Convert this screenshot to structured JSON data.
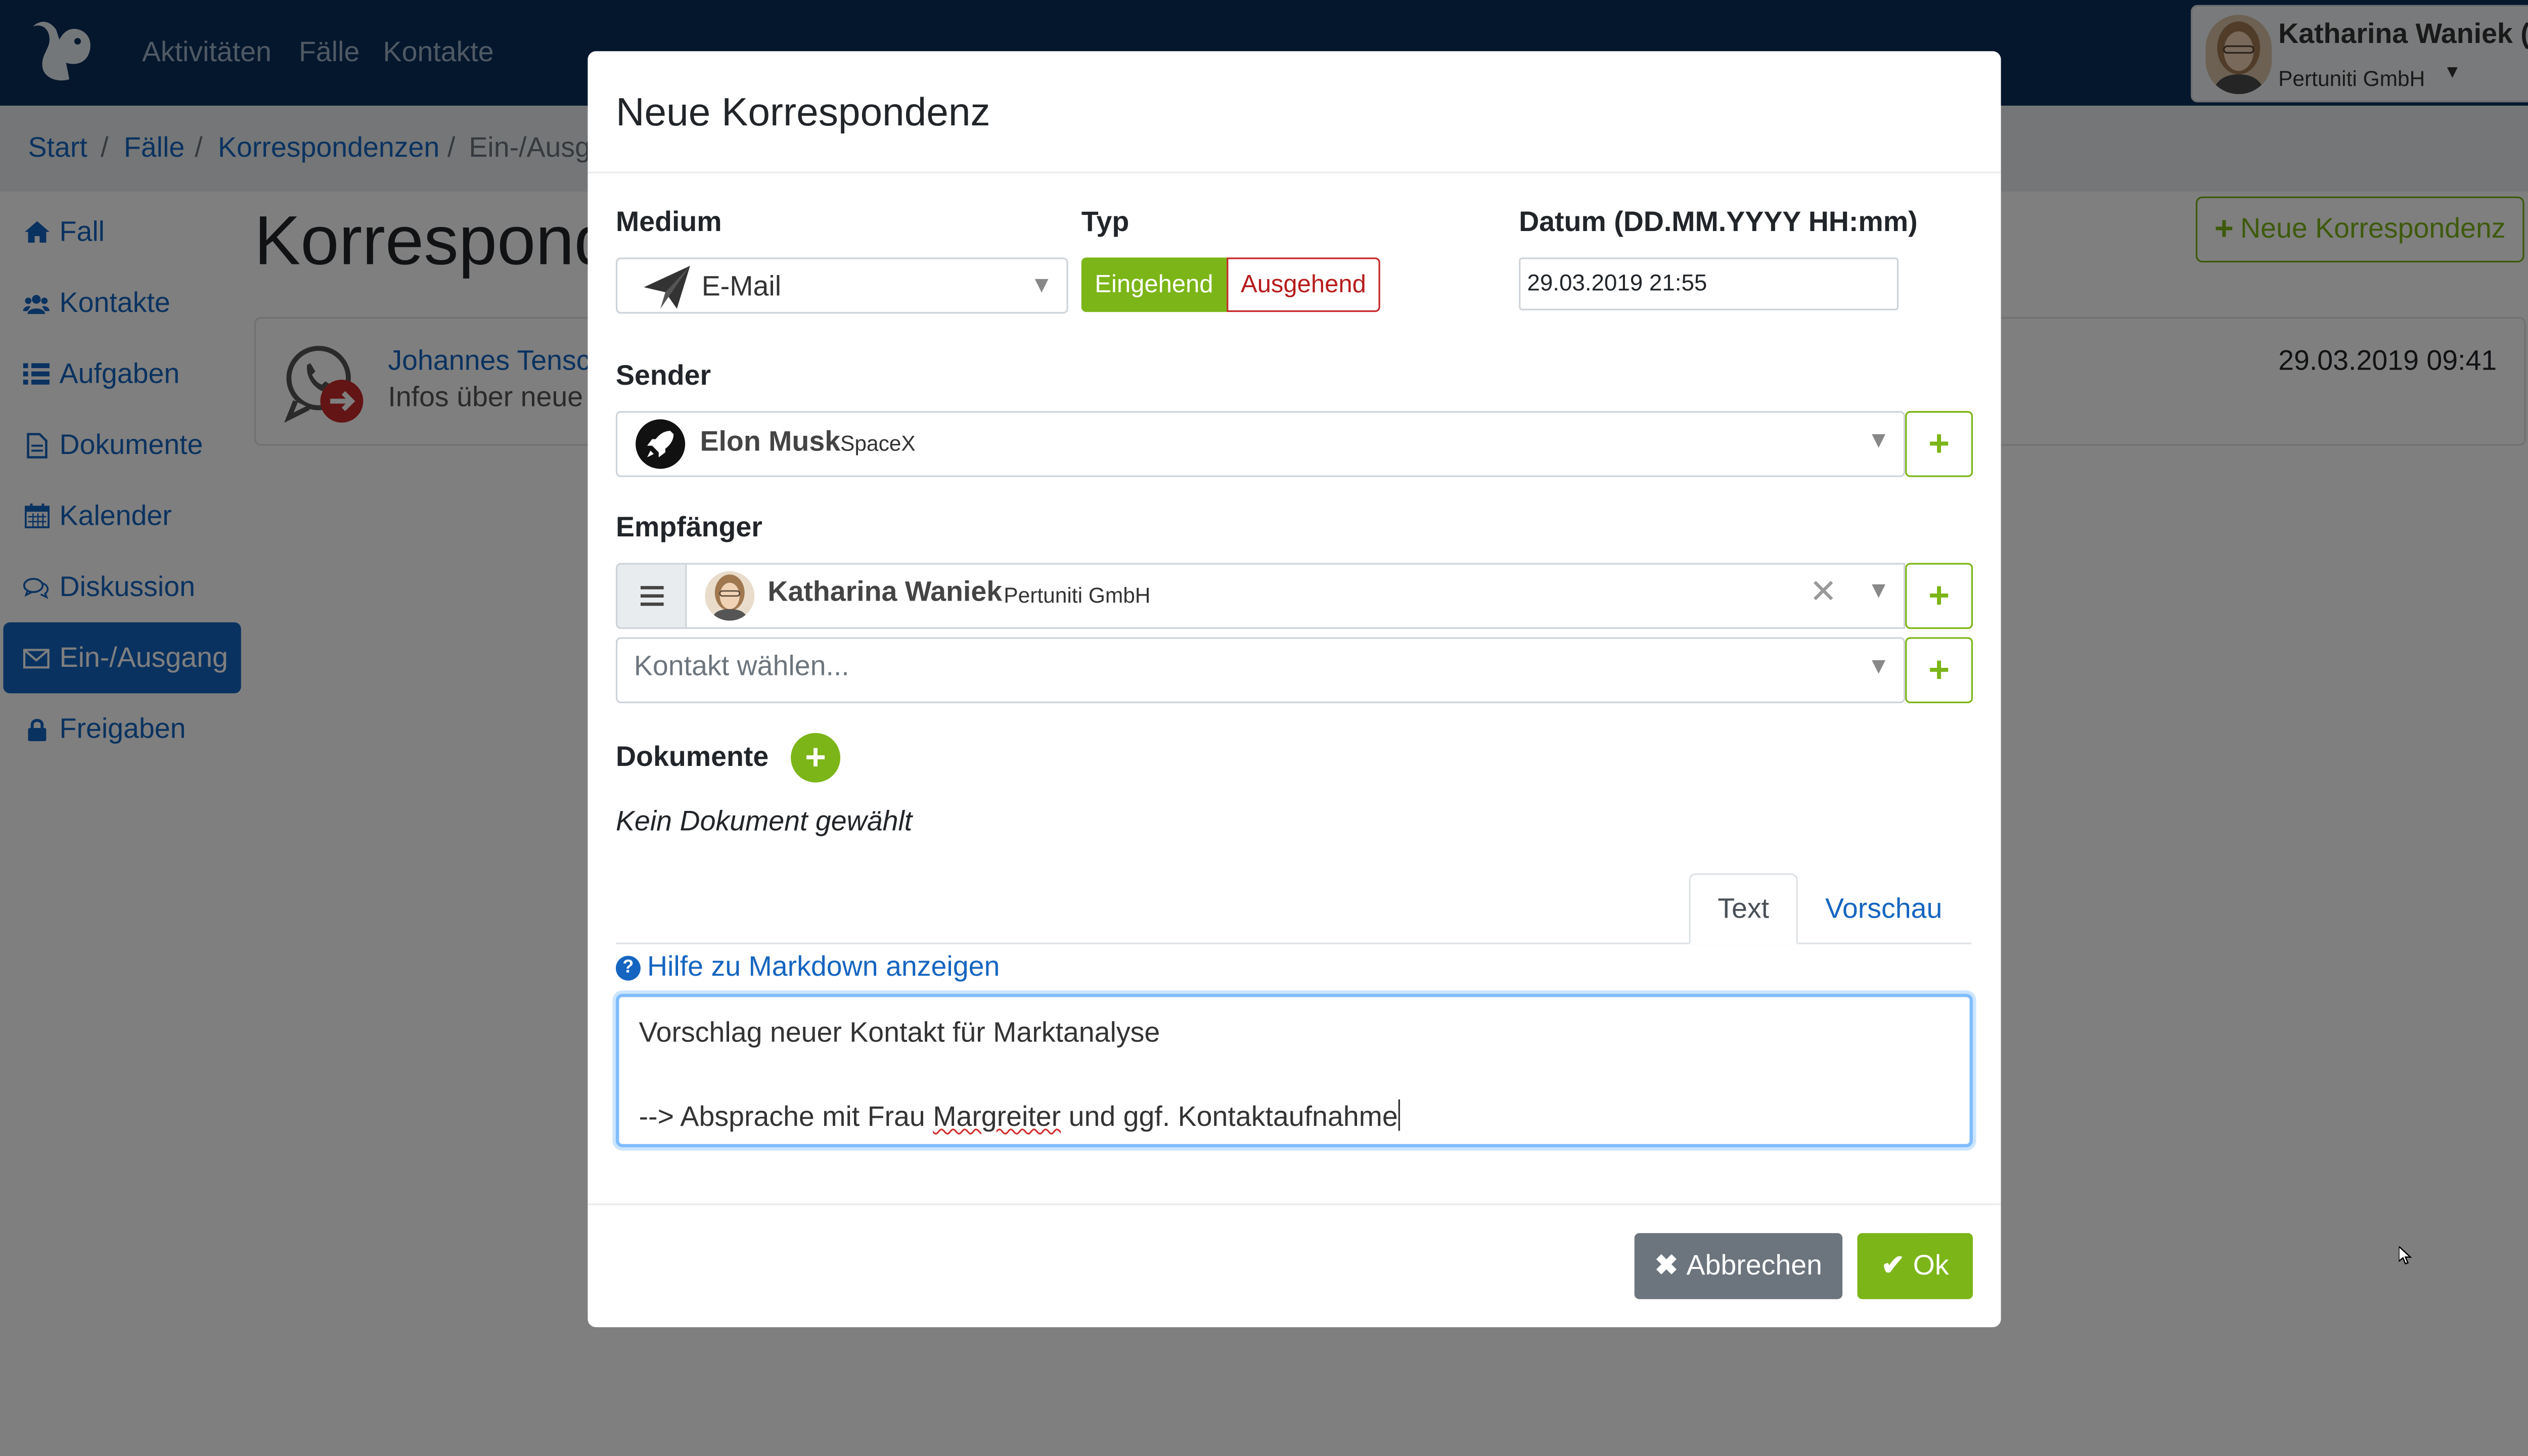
{
  "app": {
    "nav": [
      "Aktivitäten",
      "Fälle",
      "Kontakte"
    ],
    "user": {
      "name": "Katharina Waniek (kw)",
      "company": "Pertuniti GmbH"
    }
  },
  "breadcrumb": [
    "Start",
    "Fälle",
    "Korrespondenzen",
    "Ein-/Ausgang"
  ],
  "sidebar": {
    "items": [
      {
        "label": "Fall",
        "icon": "home-icon"
      },
      {
        "label": "Kontakte",
        "icon": "users-icon"
      },
      {
        "label": "Aufgaben",
        "icon": "list-icon"
      },
      {
        "label": "Dokumente",
        "icon": "document-icon"
      },
      {
        "label": "Kalender",
        "icon": "calendar-icon"
      },
      {
        "label": "Diskussion",
        "icon": "comments-icon"
      },
      {
        "label": "Ein-/Ausgang",
        "icon": "envelope-icon",
        "active": true
      },
      {
        "label": "Freigaben",
        "icon": "lock-icon"
      }
    ]
  },
  "page": {
    "title": "Korrespondenzen",
    "new_button": "Neue Korrespondenz",
    "entry": {
      "name": "Johannes Tenschert",
      "description": "Infos über neue Produkte",
      "date": "29.03.2019 09:41"
    }
  },
  "modal": {
    "title": "Neue Korrespondenz",
    "medium_label": "Medium",
    "medium_value": "E-Mail",
    "typ_label": "Typ",
    "typ_incoming": "Eingehend",
    "typ_outgoing": "Ausgehend",
    "date_label": "Datum (DD.MM.YYYY HH:mm)",
    "date_value": "29.03.2019 21:55",
    "sender_label": "Sender",
    "sender_name": "Elon Musk",
    "sender_org": "SpaceX",
    "recipient_label": "Empfänger",
    "recipient_name": "Katharina Waniek",
    "recipient_org": "Pertuniti GmbH",
    "contact_placeholder": "Kontakt wählen...",
    "documents_label": "Dokumente",
    "no_document": "Kein Dokument gewählt",
    "tab_text": "Text",
    "tab_preview": "Vorschau",
    "markdown_help": "Hilfe zu Markdown anzeigen",
    "text_line1": "Vorschlag neuer Kontakt für Marktanalyse",
    "text_line2_a": "--> Absprache mit Frau ",
    "text_line2_b": "Margreiter",
    "text_line2_c": " und ggf. Kontaktaufnahme",
    "cancel": "Abbrechen",
    "ok": "Ok"
  },
  "colors": {
    "navbar": "#0b2f5b",
    "accent": "#7cb518",
    "link": "#1565c0",
    "danger": "#c62828"
  }
}
